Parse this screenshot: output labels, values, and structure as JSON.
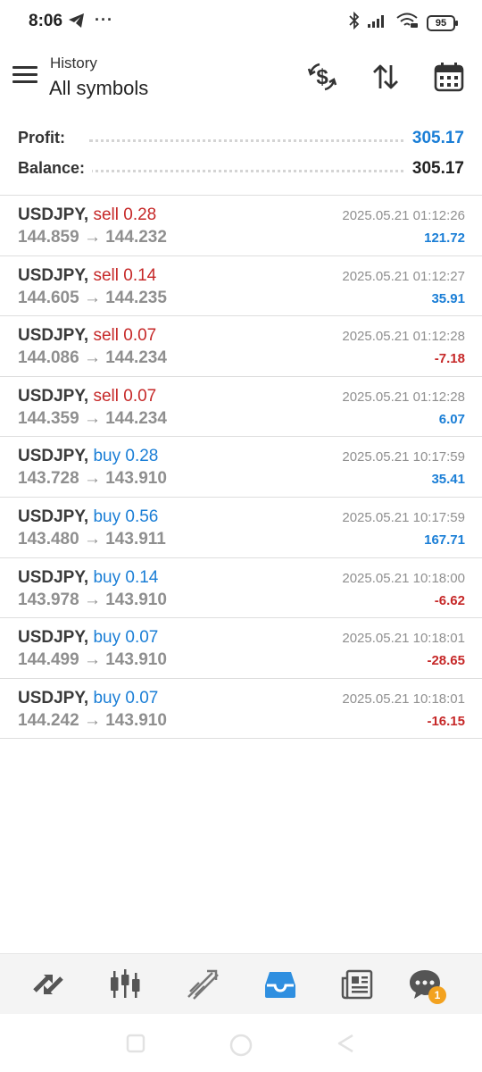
{
  "status_bar": {
    "time": "8:06",
    "dots": "···",
    "battery": "95"
  },
  "header": {
    "subtitle": "History",
    "title": "All symbols",
    "icons": [
      "menu-icon",
      "currency-exchange-icon",
      "sort-icon",
      "calendar-icon"
    ]
  },
  "summary": {
    "profit_label": "Profit:",
    "profit_value": "305.17",
    "balance_label": "Balance:",
    "balance_value": "305.17",
    "profit_color": "#1a7ed6"
  },
  "deals": [
    {
      "symbol": "USDJPY,",
      "action": "sell 0.28",
      "prices": "144.859 → 144.232",
      "time": "2025.05.21 01:12:26",
      "profit": "121.72"
    },
    {
      "symbol": "USDJPY,",
      "action": "sell 0.14",
      "prices": "144.605 → 144.235",
      "time": "2025.05.21 01:12:27",
      "profit": "35.91"
    },
    {
      "symbol": "USDJPY,",
      "action": "sell 0.07",
      "prices": "144.086 → 144.234",
      "time": "2025.05.21 01:12:28",
      "profit": "-7.18"
    },
    {
      "symbol": "USDJPY,",
      "action": "sell 0.07",
      "prices": "144.359 → 144.234",
      "time": "2025.05.21 01:12:28",
      "profit": "6.07"
    },
    {
      "symbol": "USDJPY,",
      "action": "buy 0.28",
      "prices": "143.728 → 143.910",
      "time": "2025.05.21 10:17:59",
      "profit": "35.41"
    },
    {
      "symbol": "USDJPY,",
      "action": "buy 0.56",
      "prices": "143.480 → 143.911",
      "time": "2025.05.21 10:17:59",
      "profit": "167.71"
    },
    {
      "symbol": "USDJPY,",
      "action": "buy 0.14",
      "prices": "143.978 → 143.910",
      "time": "2025.05.21 10:18:00",
      "profit": "-6.62"
    },
    {
      "symbol": "USDJPY,",
      "action": "buy 0.07",
      "prices": "144.499 → 143.910",
      "time": "2025.05.21 10:18:01",
      "profit": "-28.65"
    },
    {
      "symbol": "USDJPY,",
      "action": "buy 0.07",
      "prices": "144.242 → 143.910",
      "time": "2025.05.21 10:18:01",
      "profit": "-16.15"
    }
  ],
  "colors": {
    "sell": "#c62828",
    "buy": "#1a7ed6",
    "positive": "#1a7ed6",
    "negative": "#c62828",
    "active_tab": "#2f8fe0",
    "badge": "#f3a21f"
  },
  "bottom_nav": {
    "items": [
      "quotes-icon",
      "chart-icon",
      "trade-icon",
      "history-icon",
      "news-icon",
      "messages-icon"
    ],
    "active": "history-icon",
    "messages_badge": "1"
  }
}
